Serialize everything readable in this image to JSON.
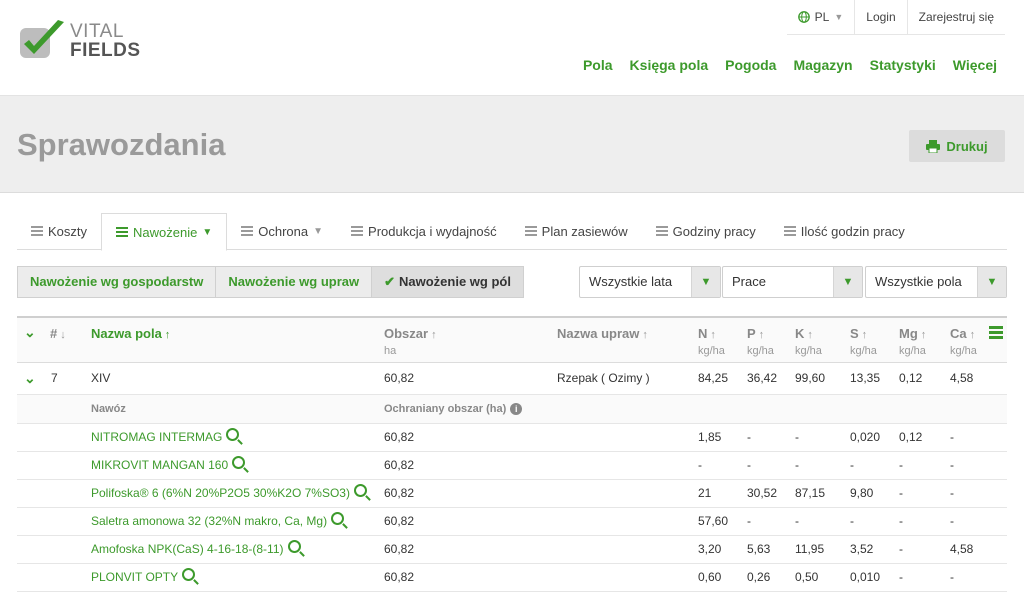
{
  "brand": {
    "logo_line1": "VITAL",
    "logo_line2": "FIELDS",
    "accent_color": "#3d9a2c"
  },
  "topbar": {
    "language": "PL",
    "login": "Login",
    "register": "Zarejestruj się"
  },
  "mainnav": [
    "Pola",
    "Księga pola",
    "Pogoda",
    "Magazyn",
    "Statystyki",
    "Więcej"
  ],
  "page": {
    "title": "Sprawozdania",
    "print_label": "Drukuj"
  },
  "tabs": [
    {
      "label": "Koszty"
    },
    {
      "label": "Nawożenie",
      "active": true
    },
    {
      "label": "Ochrona"
    },
    {
      "label": "Produkcja i wydajność"
    },
    {
      "label": "Plan zasiewów"
    },
    {
      "label": "Godziny pracy"
    },
    {
      "label": "Ilość godzin pracy"
    }
  ],
  "subtabs": [
    {
      "label": "Nawożenie wg gospodarstw"
    },
    {
      "label": "Nawożenie wg upraw"
    },
    {
      "label": "Nawożenie wg pól",
      "active": true
    }
  ],
  "filters": {
    "years": "Wszystkie lata",
    "works": "Prace",
    "fields": "Wszystkie pola"
  },
  "table": {
    "headers": {
      "hash": "#",
      "field_name": "Nazwa pola",
      "area": "Obszar",
      "area_unit": "ha",
      "crop": "Nazwa upraw",
      "N": "N",
      "P": "P",
      "K": "K",
      "S": "S",
      "Mg": "Mg",
      "Ca": "Ca",
      "unit": "kg/ha"
    },
    "main_row": {
      "num": "7",
      "name": "XIV",
      "area": "60,82",
      "crop": "Rzepak ( Ozimy )",
      "N": "84,25",
      "P": "36,42",
      "K": "99,60",
      "S": "13,35",
      "Mg": "0,12",
      "Ca": "4,58"
    },
    "sub_header": {
      "fertilizer": "Nawóz",
      "protected_area": "Ochraniany obszar (ha)"
    },
    "fertilizers": [
      {
        "name": "NITROMAG INTERMAG",
        "area": "60,82",
        "N": "1,85",
        "P": "-",
        "K": "-",
        "S": "0,020",
        "Mg": "0,12",
        "Ca": "-"
      },
      {
        "name": "MIKROVIT MANGAN 160",
        "area": "60,82",
        "N": "-",
        "P": "-",
        "K": "-",
        "S": "-",
        "Mg": "-",
        "Ca": "-"
      },
      {
        "name": "Polifoska® 6 (6%N 20%P2O5 30%K2O 7%SO3)",
        "area": "60,82",
        "N": "21",
        "P": "30,52",
        "K": "87,15",
        "S": "9,80",
        "Mg": "-",
        "Ca": "-"
      },
      {
        "name": "Saletra amonowa 32 (32%N makro, Ca, Mg)",
        "area": "60,82",
        "N": "57,60",
        "P": "-",
        "K": "-",
        "S": "-",
        "Mg": "-",
        "Ca": "-"
      },
      {
        "name": "Amofoska NPK(CaS) 4-16-18-(8-11)",
        "area": "60,82",
        "N": "3,20",
        "P": "5,63",
        "K": "11,95",
        "S": "3,52",
        "Mg": "-",
        "Ca": "4,58"
      },
      {
        "name": "PLONVIT OPTY",
        "area": "60,82",
        "N": "0,60",
        "P": "0,26",
        "K": "0,50",
        "S": "0,010",
        "Mg": "-",
        "Ca": "-"
      }
    ]
  }
}
